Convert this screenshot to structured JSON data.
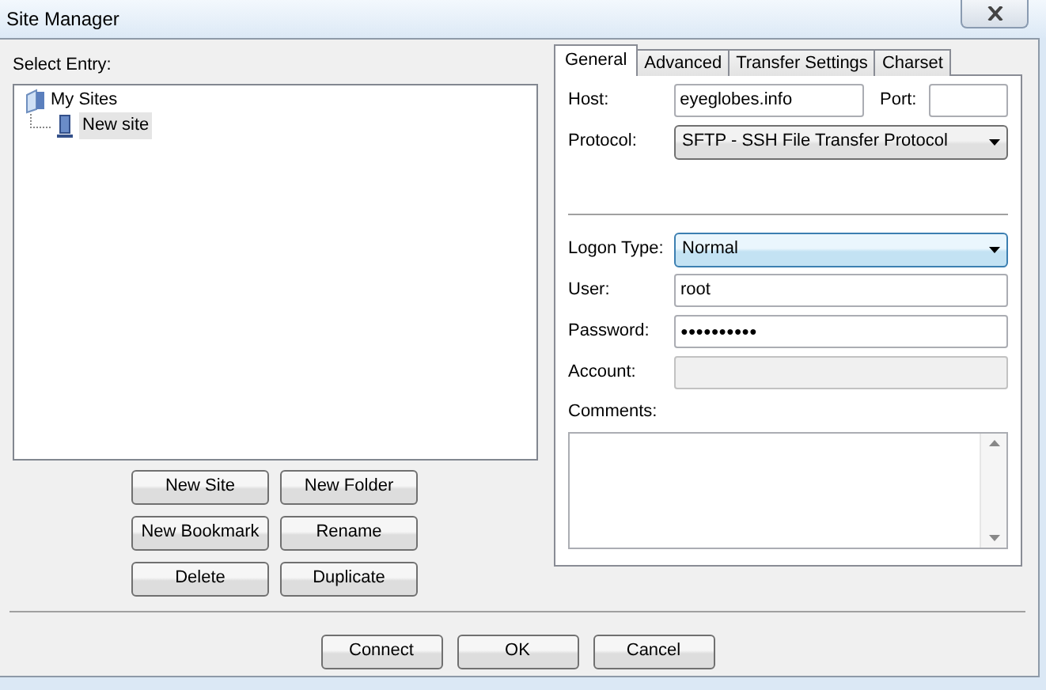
{
  "window": {
    "title": "Site Manager"
  },
  "select_entry": {
    "label": "Select Entry:",
    "tree": [
      {
        "label": "My Sites",
        "selected": false,
        "children": [
          {
            "label": "New site",
            "selected": true
          }
        ]
      }
    ]
  },
  "entry_buttons": [
    "New Site",
    "New Folder",
    "New Bookmark",
    "Rename",
    "Delete",
    "Duplicate"
  ],
  "tabs": [
    {
      "label": "General",
      "selected": true
    },
    {
      "label": "Advanced",
      "selected": false
    },
    {
      "label": "Transfer Settings",
      "selected": false
    },
    {
      "label": "Charset",
      "selected": false
    }
  ],
  "general": {
    "host": {
      "label": "Host:",
      "value": "eyeglobes.info"
    },
    "port": {
      "label": "Port:"
    },
    "protocol": {
      "label": "Protocol:",
      "value": "SFTP - SSH File Transfer Protocol"
    },
    "logon_type": {
      "label": "Logon Type:",
      "value": "Normal",
      "focused": true
    },
    "user": {
      "label": "User:",
      "value": "root",
      "disabled": false
    },
    "password": {
      "label": "Password:",
      "value": "●●●●●●●●●●",
      "disabled": false
    },
    "account": {
      "label": "Account:",
      "disabled": true
    },
    "comments": {
      "label": "Comments:"
    }
  },
  "buttons": [
    "Connect",
    "OK",
    "Cancel"
  ]
}
